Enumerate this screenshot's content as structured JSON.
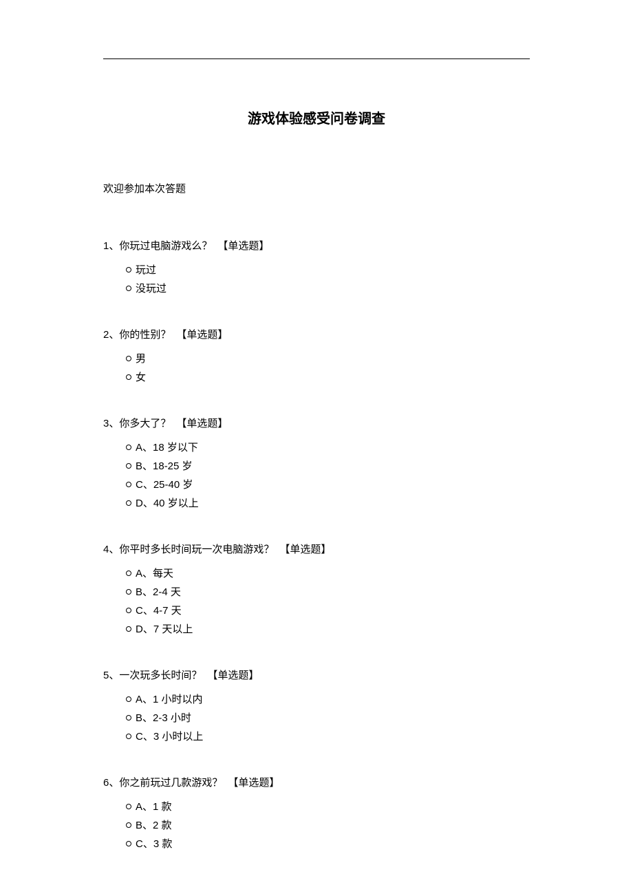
{
  "title": "游戏体验感受问卷调查",
  "intro": "欢迎参加本次答题",
  "type_label_single": "【单选题】",
  "questions": [
    {
      "number": "1、",
      "text": "你玩过电脑游戏么？",
      "options": [
        "玩过",
        "没玩过"
      ]
    },
    {
      "number": "2、",
      "text": "你的性别？",
      "options": [
        "男",
        "女"
      ]
    },
    {
      "number": "3、",
      "text": "你多大了？",
      "options": [
        "A、18 岁以下",
        "B、18-25 岁",
        "C、25-40 岁",
        "D、40 岁以上"
      ]
    },
    {
      "number": "4、",
      "text": "你平时多长时间玩一次电脑游戏？",
      "options": [
        "A、每天",
        "B、2-4 天",
        "C、4-7 天",
        "D、7 天以上"
      ]
    },
    {
      "number": "5、",
      "text": "一次玩多长时间？",
      "options": [
        "A、1 小时以内",
        "B、2-3 小时",
        "C、3 小时以上"
      ]
    },
    {
      "number": "6、",
      "text": "你之前玩过几款游戏？",
      "options": [
        "A、1 款",
        "B、2 款",
        "C、3 款"
      ]
    }
  ]
}
